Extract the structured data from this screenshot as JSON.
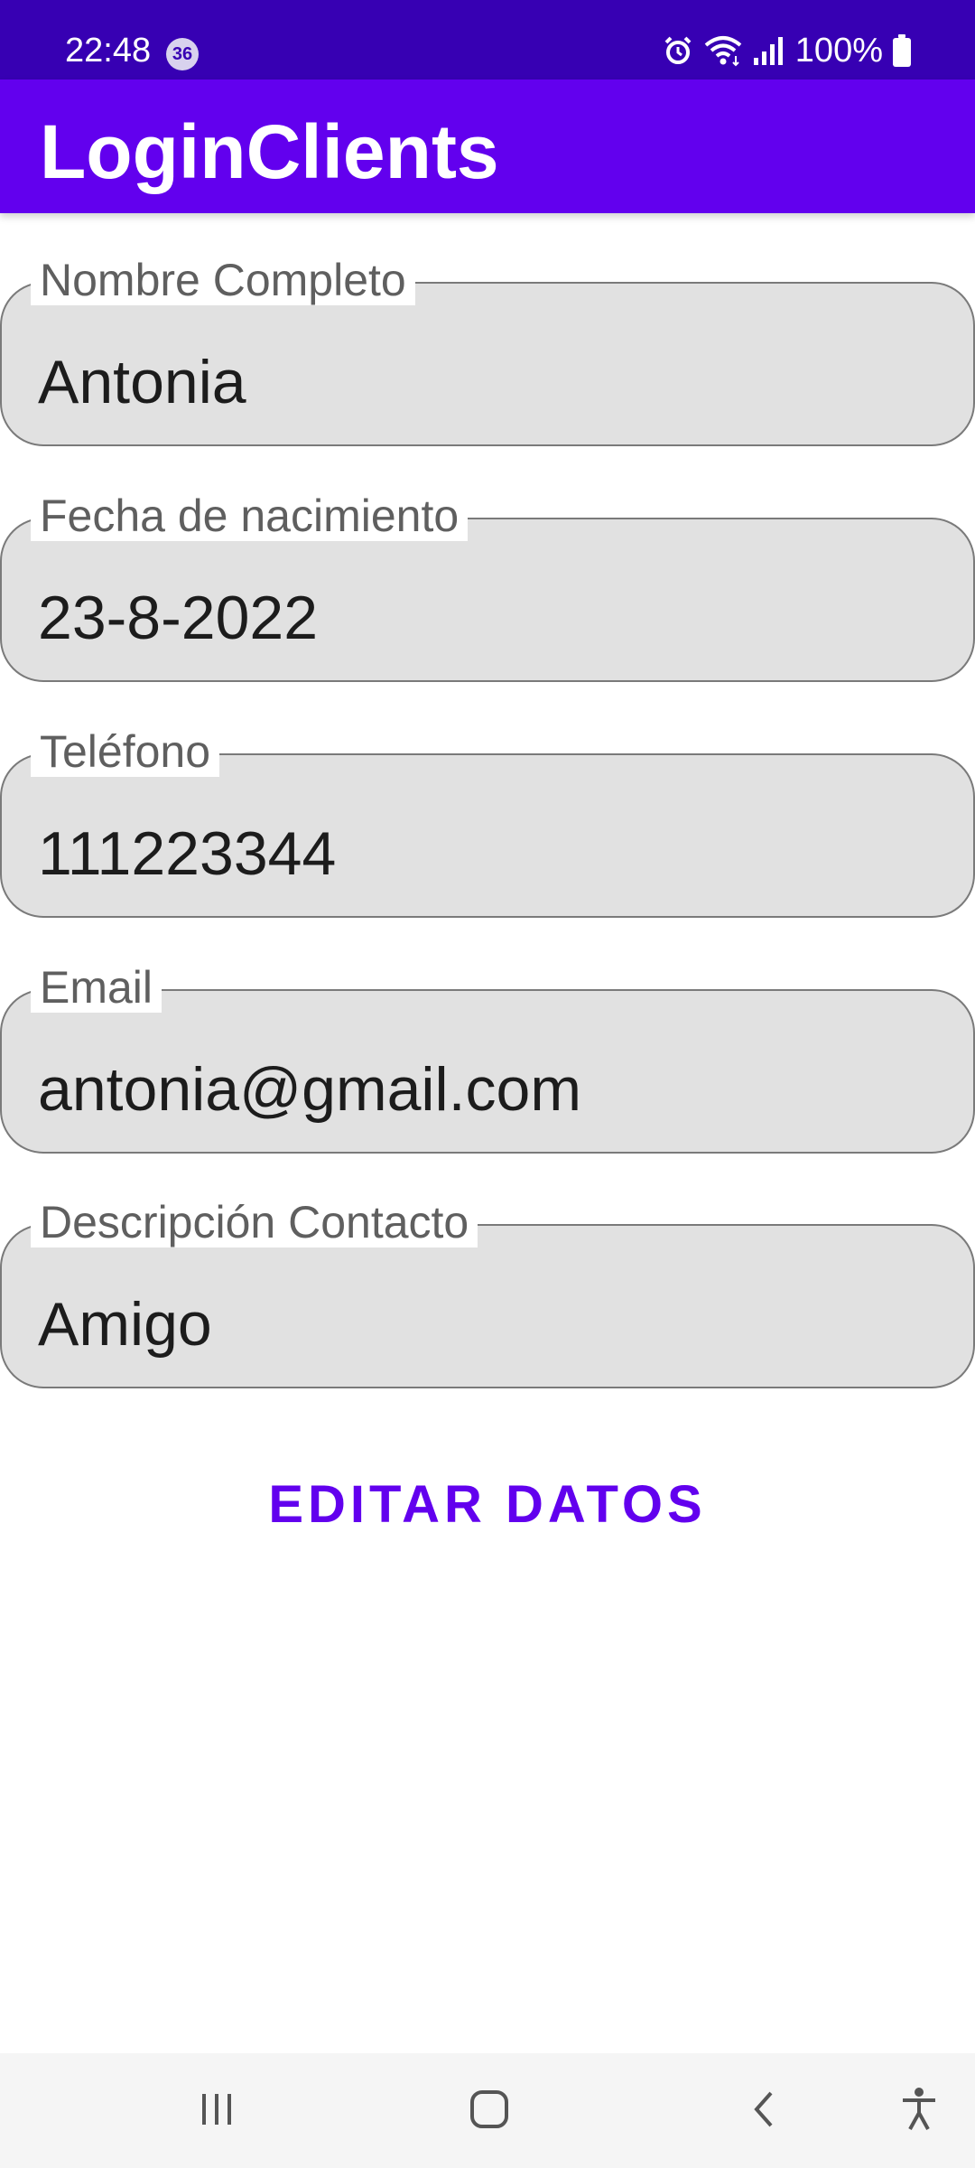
{
  "status_bar": {
    "time": "22:48",
    "notification_count": "36",
    "battery": "100%",
    "icons": [
      "alarm-icon",
      "wifi-icon",
      "signal-icon",
      "battery-icon"
    ]
  },
  "app_bar": {
    "title": "LoginClients",
    "background": "#6200ee"
  },
  "form": {
    "fields": [
      {
        "label": "Nombre Completo",
        "value": "Antonia"
      },
      {
        "label": "Fecha de nacimiento",
        "value": "23-8-2022"
      },
      {
        "label": "Teléfono",
        "value": "111223344"
      },
      {
        "label": "Email",
        "value": "antonia@gmail.com"
      },
      {
        "label": "Descripción Contacto",
        "value": "Amigo"
      }
    ]
  },
  "actions": {
    "edit_label": "EDITAR DATOS",
    "accent": "#6200ee"
  },
  "nav_bar": {
    "icons": [
      "recents-icon",
      "home-icon",
      "back-icon",
      "accessibility-icon"
    ]
  },
  "colors": {
    "status_bar": "#3700b3",
    "field_fill": "#e1e1e1",
    "field_border": "#7a7a7a"
  }
}
